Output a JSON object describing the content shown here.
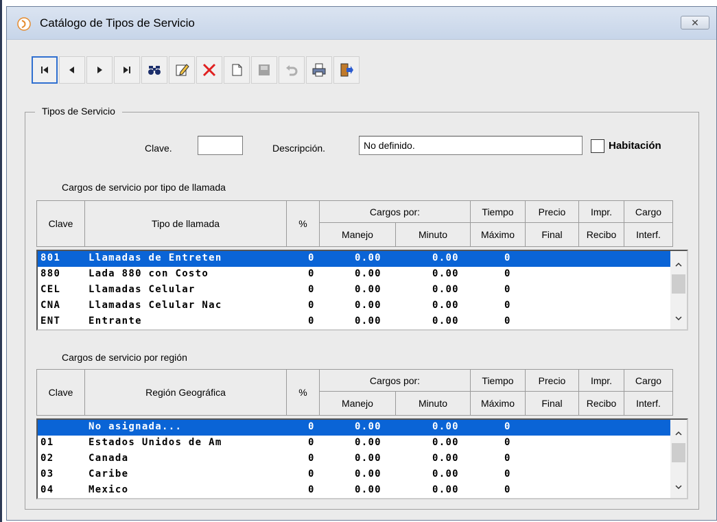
{
  "window": {
    "title": "Catálogo de Tipos de Servicio"
  },
  "toolbar": {
    "buttons": [
      {
        "name": "first-record-icon"
      },
      {
        "name": "previous-record-icon"
      },
      {
        "name": "next-record-icon"
      },
      {
        "name": "last-record-icon"
      },
      {
        "name": "search-binoculars-icon"
      },
      {
        "name": "edit-icon"
      },
      {
        "name": "delete-icon"
      },
      {
        "name": "new-document-icon"
      },
      {
        "name": "save-icon"
      },
      {
        "name": "undo-icon"
      },
      {
        "name": "print-icon"
      },
      {
        "name": "exit-door-icon"
      }
    ]
  },
  "group": {
    "legend": "Tipos de Servicio"
  },
  "form": {
    "clave_label": "Clave.",
    "clave_value": "",
    "descripcion_label": "Descripción.",
    "descripcion_value": "No definido.",
    "habitacion_label": "Habitación",
    "habitacion_checked": false
  },
  "table1": {
    "caption": "Cargos de servicio por tipo de llamada",
    "headers": {
      "clave": "Clave",
      "desc": "Tipo de llamada",
      "pct": "%",
      "cargos_por": "Cargos por:",
      "manejo": "Manejo",
      "minuto": "Minuto",
      "tiempo": "Tiempo",
      "maximo": "Máximo",
      "precio": "Precio",
      "final": "Final",
      "impr": "Impr.",
      "recibo": "Recibo",
      "cargo": "Cargo",
      "interf": "Interf."
    },
    "rows": [
      {
        "clave": "801",
        "desc": "Llamadas de Entreten",
        "pct": "0",
        "manejo": "0.00",
        "minuto": "0.00",
        "tiempo": "0",
        "selected": true
      },
      {
        "clave": "880",
        "desc": "Lada 880 con Costo",
        "pct": "0",
        "manejo": "0.00",
        "minuto": "0.00",
        "tiempo": "0",
        "selected": false
      },
      {
        "clave": "CEL",
        "desc": "Llamadas Celular",
        "pct": "0",
        "manejo": "0.00",
        "minuto": "0.00",
        "tiempo": "0",
        "selected": false
      },
      {
        "clave": "CNA",
        "desc": "Llamadas Celular Nac",
        "pct": "0",
        "manejo": "0.00",
        "minuto": "0.00",
        "tiempo": "0",
        "selected": false
      },
      {
        "clave": "ENT",
        "desc": "Entrante",
        "pct": "0",
        "manejo": "0.00",
        "minuto": "0.00",
        "tiempo": "0",
        "selected": false
      }
    ]
  },
  "table2": {
    "caption": "Cargos de servicio por región",
    "headers": {
      "clave": "Clave",
      "desc": "Región Geográfica",
      "pct": "%",
      "cargos_por": "Cargos por:",
      "manejo": "Manejo",
      "minuto": "Minuto",
      "tiempo": "Tiempo",
      "maximo": "Máximo",
      "precio": "Precio",
      "final": "Final",
      "impr": "Impr.",
      "recibo": "Recibo",
      "cargo": "Cargo",
      "interf": "Interf."
    },
    "rows": [
      {
        "clave": "",
        "desc": "No asignada...",
        "pct": "0",
        "manejo": "0.00",
        "minuto": "0.00",
        "tiempo": "0",
        "selected": true
      },
      {
        "clave": "01",
        "desc": "Estados Unidos de Am",
        "pct": "0",
        "manejo": "0.00",
        "minuto": "0.00",
        "tiempo": "0",
        "selected": false
      },
      {
        "clave": "02",
        "desc": "Canada",
        "pct": "0",
        "manejo": "0.00",
        "minuto": "0.00",
        "tiempo": "0",
        "selected": false
      },
      {
        "clave": "03",
        "desc": "Caribe",
        "pct": "0",
        "manejo": "0.00",
        "minuto": "0.00",
        "tiempo": "0",
        "selected": false
      },
      {
        "clave": "04",
        "desc": "Mexico",
        "pct": "0",
        "manejo": "0.00",
        "minuto": "0.00",
        "tiempo": "0",
        "selected": false
      }
    ]
  },
  "colors": {
    "selection": "#0a64d6",
    "accent_border": "#2f6fd0"
  }
}
